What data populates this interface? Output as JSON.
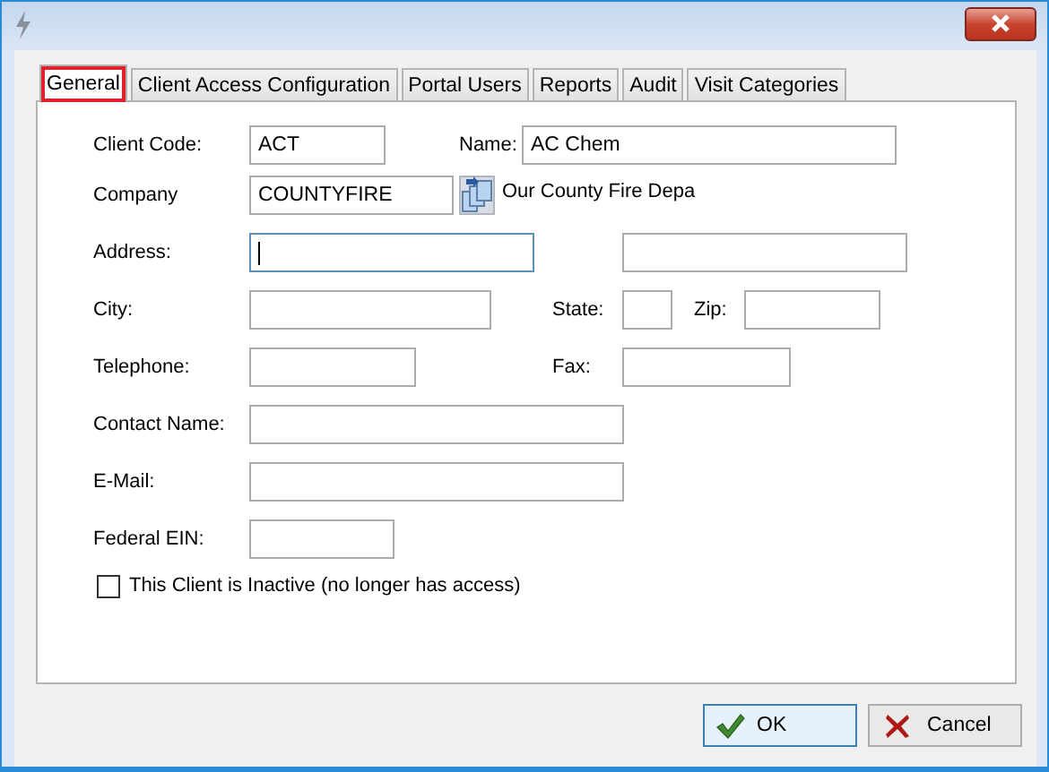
{
  "tabs": [
    {
      "label": "General",
      "selected": true,
      "highlighted": true
    },
    {
      "label": "Client Access Configuration",
      "selected": false,
      "highlighted": false
    },
    {
      "label": "Portal Users",
      "selected": false,
      "highlighted": false
    },
    {
      "label": "Reports",
      "selected": false,
      "highlighted": false
    },
    {
      "label": "Audit",
      "selected": false,
      "highlighted": false
    },
    {
      "label": "Visit Categories",
      "selected": false,
      "highlighted": false
    }
  ],
  "form": {
    "client_code": {
      "label": "Client Code:",
      "value": "ACT"
    },
    "name": {
      "label": "Name:",
      "value": "AC Chem"
    },
    "company": {
      "label": "Company",
      "value": "COUNTYFIRE",
      "description": "Our County Fire Depa"
    },
    "address": {
      "label": "Address:",
      "focused": true
    },
    "city": {
      "label": "City:"
    },
    "state": {
      "label": "State:"
    },
    "zip": {
      "label": "Zip:"
    },
    "telephone": {
      "label": "Telephone:"
    },
    "fax": {
      "label": "Fax:"
    },
    "contact_name": {
      "label": "Contact Name:"
    },
    "email": {
      "label": "E-Mail:"
    },
    "federal_ein": {
      "label": "Federal EIN:"
    },
    "inactive": {
      "label": "This Client is Inactive (no longer has access)",
      "checked": false
    }
  },
  "buttons": [
    {
      "label": "OK",
      "kind": "ok"
    },
    {
      "label": "Cancel",
      "kind": "cancel"
    }
  ]
}
